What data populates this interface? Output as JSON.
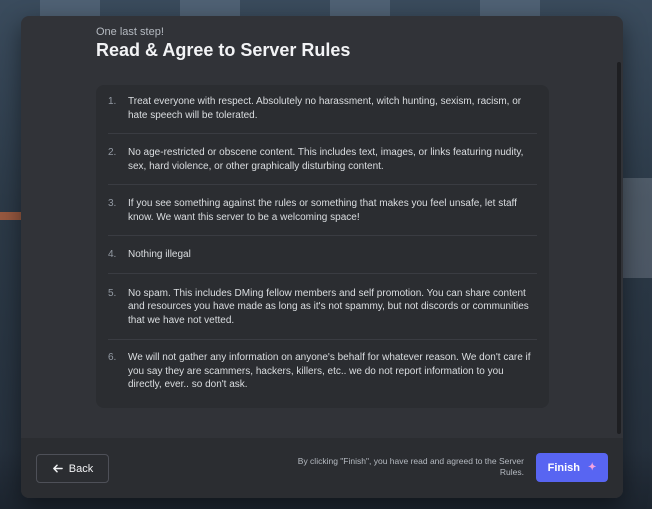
{
  "modal": {
    "eyebrow": "One last step!",
    "title": "Read & Agree to Server Rules"
  },
  "rules": [
    {
      "num": "1.",
      "text": "Treat everyone with respect. Absolutely no harassment, witch hunting, sexism, racism, or hate speech will be tolerated."
    },
    {
      "num": "2.",
      "text": "No age-restricted or obscene content. This includes text, images, or links featuring nudity, sex, hard violence, or other graphically disturbing content."
    },
    {
      "num": "3.",
      "text": "If you see something against the rules or something that makes you feel unsafe, let staff know. We want this server to be a welcoming space!"
    },
    {
      "num": "4.",
      "text": "Nothing illegal"
    },
    {
      "num": "5.",
      "text": "No spam. This includes DMing fellow members and self promotion. You can share content and resources you have made as long as it's not spammy, but not discords or communities that we have not vetted."
    },
    {
      "num": "6.",
      "text": "We will not gather any information on anyone's behalf for whatever reason. We don't care if you say they are scammers, hackers, killers, etc.. we do not report information to you directly, ever.. so don't ask."
    }
  ],
  "footer": {
    "back_label": "Back",
    "disclaimer": "By clicking \"Finish\", you have read and agreed to the Server Rules.",
    "finish_label": "Finish"
  },
  "icons": {
    "back": "arrow-left-icon",
    "finish": "sparkle-icon"
  },
  "colors": {
    "modal_bg": "#313338",
    "panel_bg": "#2b2d31",
    "accent": "#5865f2"
  }
}
